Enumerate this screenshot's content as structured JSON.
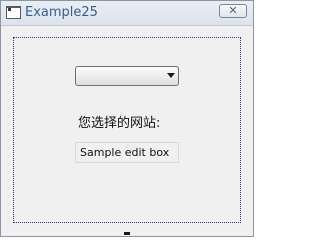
{
  "window": {
    "title": "Example25",
    "close_glyph": "✕",
    "app_icon": "window-app-icon",
    "close_icon": "close-icon"
  },
  "combo": {
    "selected_value": "",
    "arrow_icon": "dropdown-arrow-icon"
  },
  "label": {
    "text": "您选择的网站:"
  },
  "edit": {
    "value": "Sample edit box"
  }
}
